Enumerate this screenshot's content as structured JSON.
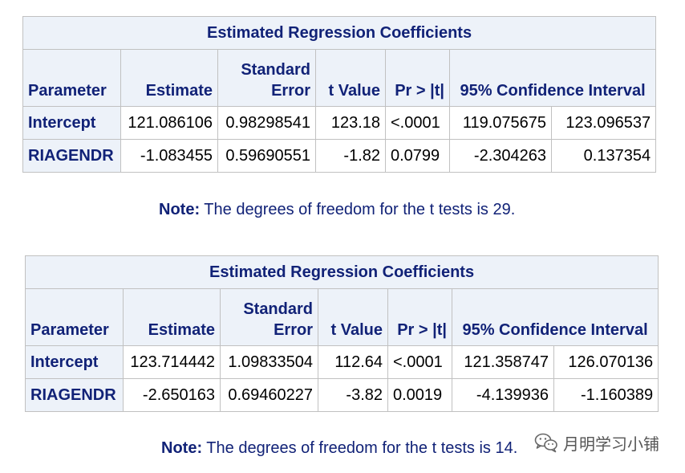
{
  "tables": [
    {
      "title": "Estimated Regression Coefficients",
      "headers": {
        "parameter": "Parameter",
        "estimate": "Estimate",
        "se_line1": "Standard",
        "se_line2": "Error",
        "tvalue": "t Value",
        "pvalue": "Pr > |t|",
        "ci": "95% Confidence Interval"
      },
      "rows": [
        {
          "parameter": "Intercept",
          "estimate": "121.086106",
          "se": "0.98298541",
          "t": "123.18",
          "p": "<.0001",
          "ci_low": "119.075675",
          "ci_high": "123.096537"
        },
        {
          "parameter": "RIAGENDR",
          "estimate": "-1.083455",
          "se": "0.59690551",
          "t": "-1.82",
          "p": "0.0799",
          "ci_low": "-2.304263",
          "ci_high": "0.137354"
        }
      ],
      "note": {
        "label": "Note:",
        "text": " The degrees of freedom for the t tests is 29."
      }
    },
    {
      "title": "Estimated Regression Coefficients",
      "headers": {
        "parameter": "Parameter",
        "estimate": "Estimate",
        "se_line1": "Standard",
        "se_line2": "Error",
        "tvalue": "t Value",
        "pvalue": "Pr > |t|",
        "ci": "95% Confidence Interval"
      },
      "rows": [
        {
          "parameter": "Intercept",
          "estimate": "123.714442",
          "se": "1.09833504",
          "t": "112.64",
          "p": "<.0001",
          "ci_low": "121.358747",
          "ci_high": "126.070136"
        },
        {
          "parameter": "RIAGENDR",
          "estimate": "-2.650163",
          "se": "0.69460227",
          "t": "-3.82",
          "p": "0.0019",
          "ci_low": "-4.139936",
          "ci_high": "-1.160389"
        }
      ],
      "note": {
        "label": "Note:",
        "text": " The degrees of freedom for the t tests is 14."
      }
    }
  ],
  "watermark": {
    "text": "月明学习小铺",
    "icon": "wechat-icon"
  },
  "colors": {
    "header_bg": "#edf2f9",
    "header_text": "#112277",
    "border": "#c1c1c1",
    "note_text": "#112277"
  }
}
